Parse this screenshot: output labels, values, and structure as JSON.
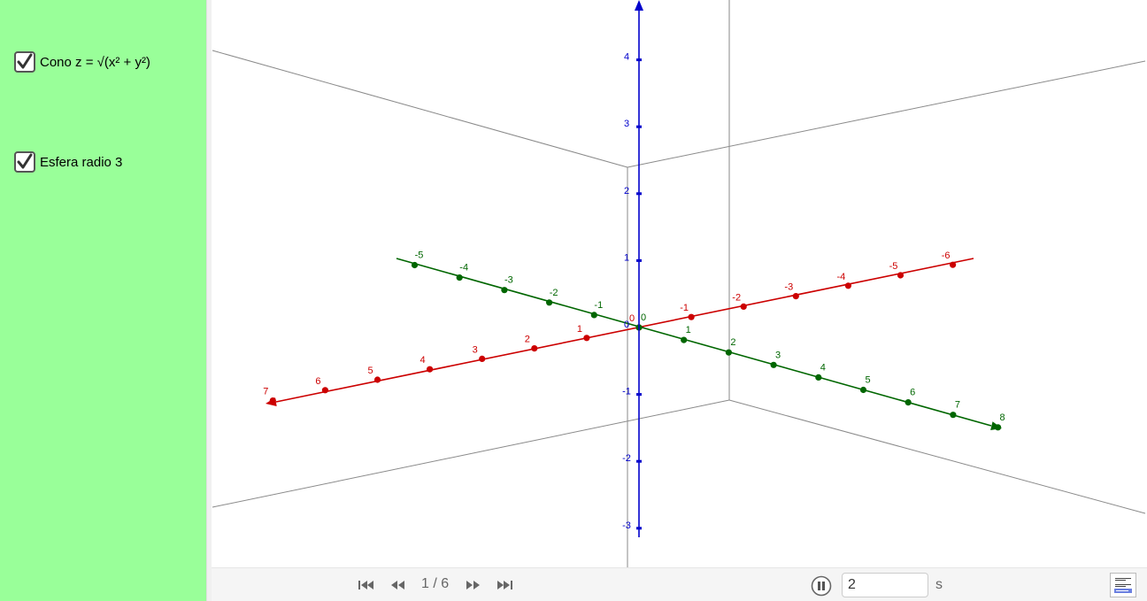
{
  "sidebar": {
    "background": "#99ff99",
    "checkboxes": [
      {
        "label": "Cono z = √(x² + y²)",
        "checked": true
      },
      {
        "label": "Esfera radio 3",
        "checked": true
      }
    ]
  },
  "axes": {
    "x_color": "#cc0000",
    "y_color": "#006600",
    "z_color": "#0000cc",
    "x_ticks": [
      "-6",
      "-5",
      "-4",
      "-3",
      "-2",
      "-1",
      "0",
      "1",
      "2",
      "3",
      "4",
      "5",
      "6",
      "7"
    ],
    "y_ticks": [
      "-5",
      "-4",
      "-3",
      "-2",
      "-1",
      "0",
      "1",
      "2",
      "3",
      "4",
      "5",
      "6",
      "7",
      "8"
    ],
    "z_ticks": [
      "4",
      "3",
      "2",
      "1",
      "0",
      "-1",
      "-2",
      "-3"
    ]
  },
  "playback": {
    "slide_counter": "1 / 6",
    "speed_value": "2",
    "speed_unit": "s"
  },
  "icons": {
    "first": "skip-to-start-icon",
    "prev": "rewind-icon",
    "next": "fast-forward-icon",
    "last": "skip-to-end-icon",
    "pause": "pause-icon",
    "algebra": "algebra-view-icon"
  }
}
